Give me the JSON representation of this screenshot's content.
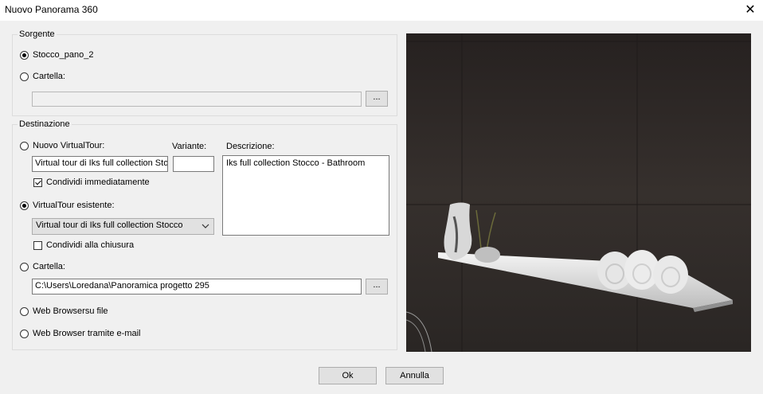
{
  "window": {
    "title": "Nuovo Panorama 360",
    "close_glyph": "✕"
  },
  "sorgente": {
    "legend": "Sorgente",
    "option_stocco": "Stocco_pano_2",
    "option_cartella": "Cartella:",
    "cartella_path": "",
    "browse_label": "..."
  },
  "destinazione": {
    "legend": "Destinazione",
    "nuovo_virtualtour": "Nuovo VirtualTour:",
    "nuovo_value": "Virtual tour di Iks full collection Sto",
    "variante_label": "Variante:",
    "variante_value": "",
    "descrizione_label": "Descrizione:",
    "descrizione_value": "Iks full collection Stocco - Bathroom",
    "condividi_immediatamente": "Condividi immediatamente",
    "virtualtour_esistente": "VirtualTour esistente:",
    "esistente_selected": "Virtual tour di Iks full collection Stocco",
    "condividi_chiusura": "Condividi alla chiusura",
    "cartella": "Cartella:",
    "cartella_path": "C:\\Users\\Loredana\\Panoramica progetto 295",
    "browse_label": "...",
    "web_browser_file": "Web Browsersu file",
    "web_browser_email": "Web Browser tramite e-mail"
  },
  "buttons": {
    "ok": "Ok",
    "annulla": "Annulla"
  },
  "colors": {
    "background": "#f0f0f0",
    "preview_dark": "#2a2524"
  }
}
